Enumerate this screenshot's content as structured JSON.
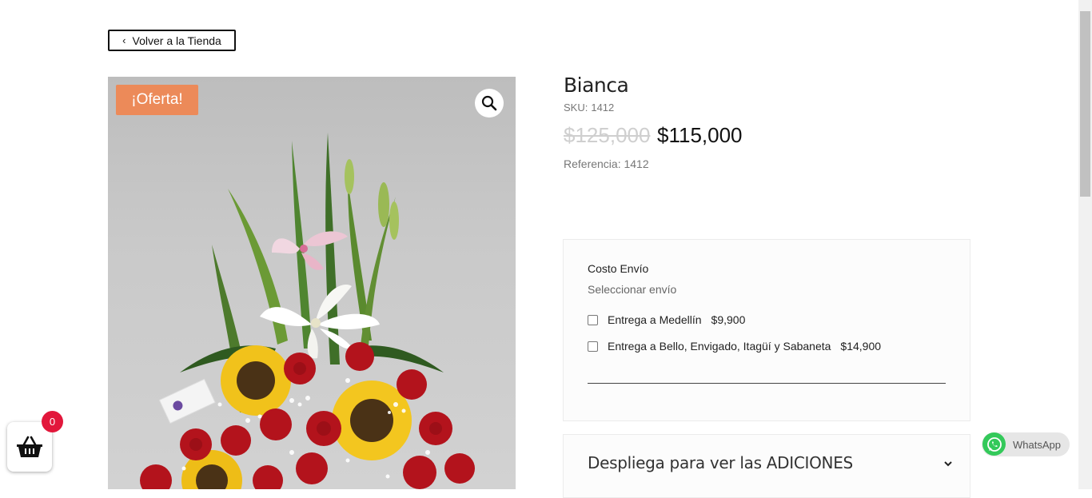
{
  "back_button": {
    "label": "Volver a la Tienda",
    "icon": "chevron-left-icon"
  },
  "product": {
    "badge": "¡Oferta!",
    "title": "Bianca",
    "sku_label": "SKU:",
    "sku_value": "1412",
    "price_old": "$125,000",
    "price_new": "$115,000",
    "reference": "Referencia: 1412",
    "image_icon": "magnifier-icon"
  },
  "shipping": {
    "title": "Costo Envío",
    "subtitle": "Seleccionar envío",
    "options": [
      {
        "label": "Entrega a Medellín",
        "price": "$9,900",
        "checked": false
      },
      {
        "label": "Entrega a Bello, Envigado, Itagüí y Sabaneta",
        "price": "$14,900",
        "checked": false
      }
    ]
  },
  "addons": {
    "label": "Despliega para ver las ADICIONES",
    "icon": "chevron-down-icon"
  },
  "cart": {
    "count": "0",
    "icon": "basket-icon"
  },
  "whatsapp": {
    "label": "WhatsApp",
    "icon": "whatsapp-icon"
  },
  "colors": {
    "badge": "#ec8a59",
    "cart_badge": "#e2173b",
    "whatsapp": "#33c95a"
  }
}
